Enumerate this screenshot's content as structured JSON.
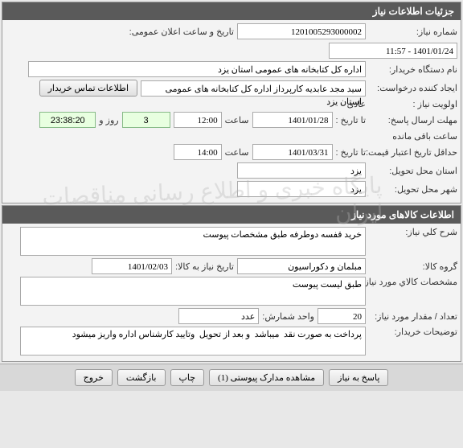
{
  "panel1": {
    "title": "جزئیات اطلاعات نیاز",
    "need_number_lbl": "شماره نیاز:",
    "need_number": "1201005293000002",
    "announce_lbl": "تاریخ و ساعت اعلان عمومی:",
    "announce": "1401/01/24 - 11:57",
    "buyer_name_lbl": "نام دستگاه خریدار:",
    "buyer_name": "اداره کل کتابخانه های عمومی استان یزد",
    "request_creator_lbl": "ایجاد کننده درخواست:",
    "request_creator": "سید مجد عابدیه کارپرداز اداره کل کتابخانه های عمومی استان یزد",
    "contact_btn": "اطلاعات تماس خریدار",
    "priority_lbl": "اولویت نیاز :",
    "priority": "عادی",
    "reply_deadline_lbl": "مهلت ارسال پاسخ:",
    "to_date_lbl": "تا تاریخ :",
    "reply_date": "1401/01/28",
    "time_lbl": "ساعت",
    "reply_time": "12:00",
    "days": "3",
    "days_and_lbl": "روز و",
    "countdown": "23:38:20",
    "remaining_lbl": "ساعت باقی مانده",
    "price_validity_lbl": "حداقل تاریخ اعتبار قیمت:",
    "price_date": "1401/03/31",
    "price_time": "14:00",
    "delivery_province_lbl": "استان محل تحویل:",
    "delivery_province": "یزد",
    "delivery_city_lbl": "شهر محل تحویل:",
    "delivery_city": "یزد"
  },
  "panel2": {
    "title": "اطلاعات کالاهای مورد نیاز",
    "desc_lbl": "شرح کلي نیاز:",
    "desc": "خرید قفسه دوطرفه طبق مشخصات پیوست",
    "group_lbl": "گروه کالا:",
    "group": "مبلمان و دکوراسیون",
    "need_date_lbl": "تاریخ نیاز به کالا:",
    "need_date": "1401/02/03",
    "spec_lbl": "مشخصات کالاي مورد نیاز:",
    "spec": "طبق لیست پیوست",
    "qty_lbl": "تعداد / مقدار مورد نیاز:",
    "qty": "20",
    "unit_lbl": "واحد شمارش:",
    "unit": "عدد",
    "buyer_notes_lbl": "توضیحات خریدار:",
    "buyer_notes": "پرداخت به صورت نقد  میباشد  و بعد از تحویل  وتایید کارشناس اداره واریز میشود"
  },
  "buttons": {
    "respond": "پاسخ به نیاز",
    "attachments": "مشاهده مدارک پیوستی (1)",
    "print": "چاپ",
    "back": "بازگشت",
    "exit": "خروج"
  },
  "watermark": "پایگاه خبری و اطلاع رسانی مناقصات ایران"
}
